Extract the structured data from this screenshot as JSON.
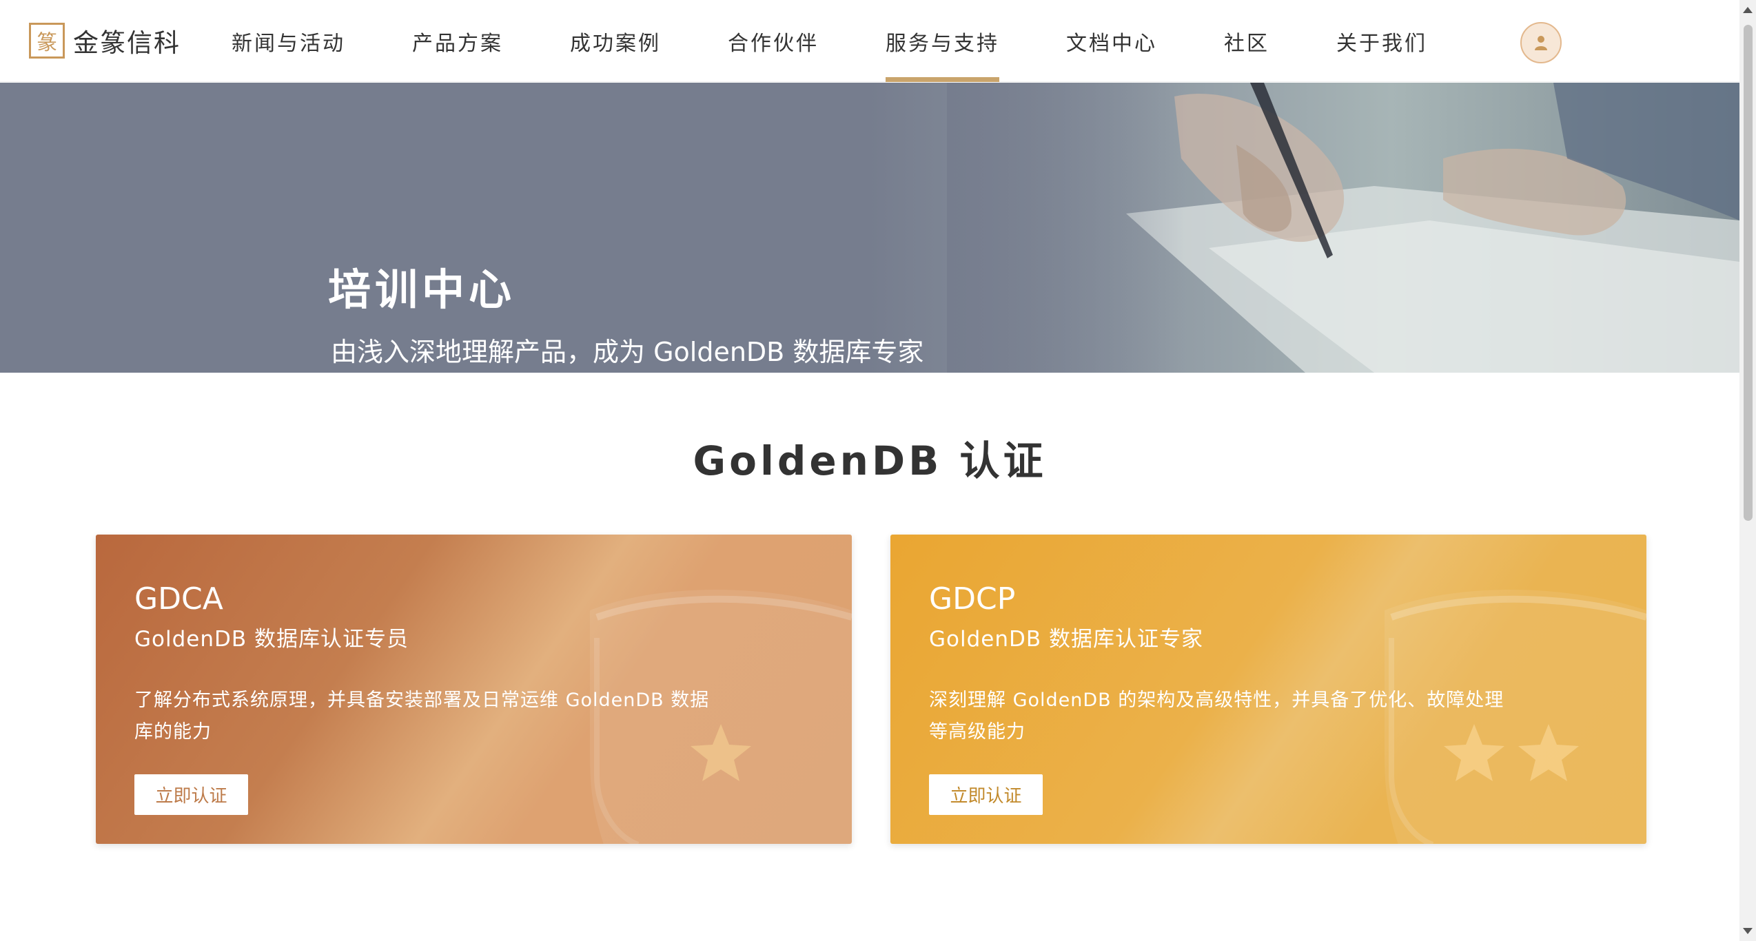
{
  "header": {
    "logo_text": "金篆信科",
    "nav": [
      {
        "label": "新闻与活动"
      },
      {
        "label": "产品方案"
      },
      {
        "label": "成功案例"
      },
      {
        "label": "合作伙伴"
      },
      {
        "label": "服务与支持",
        "active": true
      },
      {
        "label": "文档中心"
      },
      {
        "label": "社区"
      },
      {
        "label": "关于我们"
      }
    ],
    "user_icon": "user-icon"
  },
  "banner": {
    "title": "培训中心",
    "subtitle": "由浅入深地理解产品，成为 GoldenDB 数据库专家"
  },
  "certification": {
    "title": "GoldenDB 认证",
    "cards": [
      {
        "code": "GDCA",
        "name": "GoldenDB 数据库认证专员",
        "description_lines": [
          "了解分布式系统原理，并具备安装部署及日常运维 GoldenDB 数据",
          "库的能力"
        ],
        "button": "立即认证",
        "stars": 1
      },
      {
        "code": "GDCP",
        "name": "GoldenDB 数据库认证专家",
        "description_lines": [
          "深刻理解 GoldenDB 的架构及高级特性，并具备了优化、故障处理",
          "等高级能力"
        ],
        "button": "立即认证",
        "stars": 2
      }
    ]
  },
  "colors": {
    "accent": "#c9a46b",
    "card_a": "#c47e4f",
    "card_b": "#eaa632"
  }
}
